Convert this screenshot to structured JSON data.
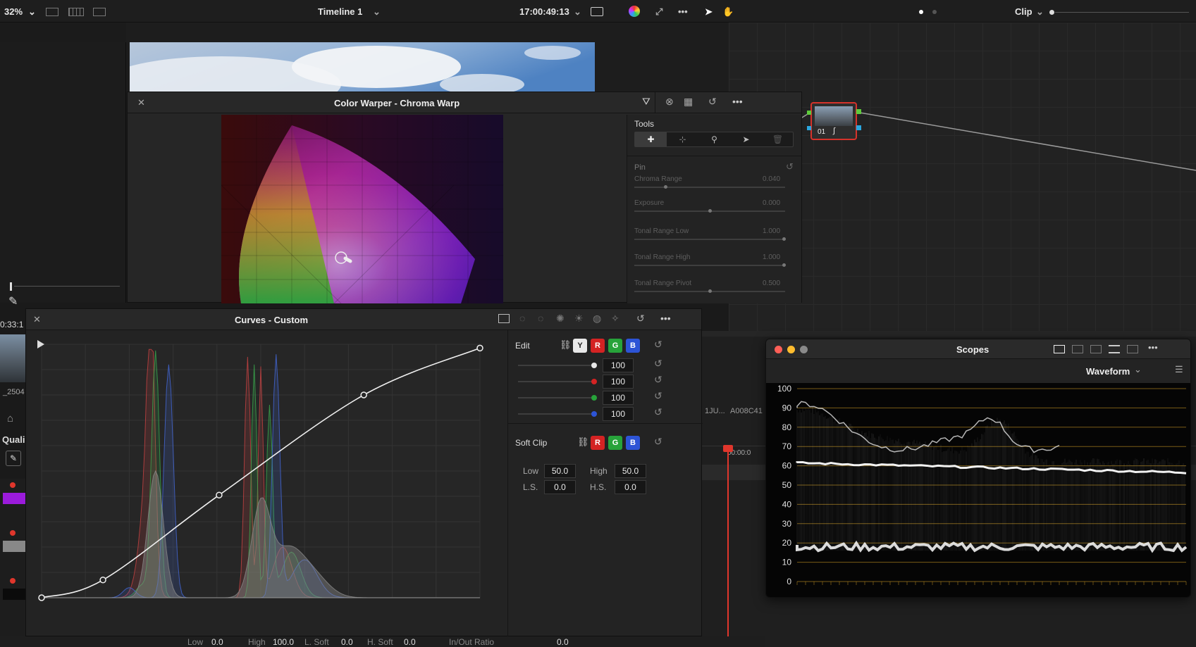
{
  "topbar": {
    "zoom": "32%",
    "timeline": "Timeline 1",
    "timecode": "17:00:49:13",
    "clip": "Clip"
  },
  "left": {
    "timecode": "0:33:1",
    "clip_label": "_2504",
    "quali_label": "Quali"
  },
  "color_warper": {
    "title": "Color Warper - Chroma Warp",
    "tools_label": "Tools",
    "pin_label": "Pin",
    "sliders": [
      {
        "label": "Chroma Range",
        "value": "0.040"
      },
      {
        "label": "Exposure",
        "value": "0.000"
      },
      {
        "label": "Tonal Range Low",
        "value": "1.000"
      },
      {
        "label": "Tonal Range High",
        "value": "1.000"
      },
      {
        "label": "Tonal Range Pivot",
        "value": "0.500"
      }
    ]
  },
  "node": {
    "label": "01"
  },
  "curves": {
    "title": "Curves - Custom",
    "edit_label": "Edit",
    "channels": [
      "Y",
      "R",
      "G",
      "B"
    ],
    "intensities": [
      "100",
      "100",
      "100",
      "100"
    ],
    "soft_clip_label": "Soft Clip",
    "soft_clip_channels": [
      "R",
      "G",
      "B"
    ],
    "low_label": "Low",
    "low_value": "50.0",
    "high_label": "High",
    "high_value": "50.0",
    "ls_label": "L.S.",
    "ls_value": "0.0",
    "hs_label": "H.S.",
    "hs_value": "0.0"
  },
  "bottombar": {
    "low_label": "Low",
    "low_value": "0.0",
    "high_label": "High",
    "high_value": "100.0",
    "lsoft_label": "L. Soft",
    "lsoft_value": "0.0",
    "hsoft_label": "H. Soft",
    "hsoft_value": "0.0",
    "ratio_label": "In/Out Ratio",
    "ratio_value": "0.0"
  },
  "timeline": {
    "clip_text_1": "1JU...",
    "clip_text_2": "A008C41",
    "playhead_tc": "00:00:0"
  },
  "scopes": {
    "title": "Scopes",
    "mode": "Waveform",
    "y_labels": [
      "100",
      "90",
      "80",
      "70",
      "60",
      "50",
      "40",
      "30",
      "20",
      "10",
      "0"
    ]
  },
  "colors": {
    "accent_red": "#e0362c",
    "chan_r": "#d42323",
    "chan_g": "#27a33a",
    "chan_b": "#2d54d6",
    "graticule": "#a07a1c"
  }
}
